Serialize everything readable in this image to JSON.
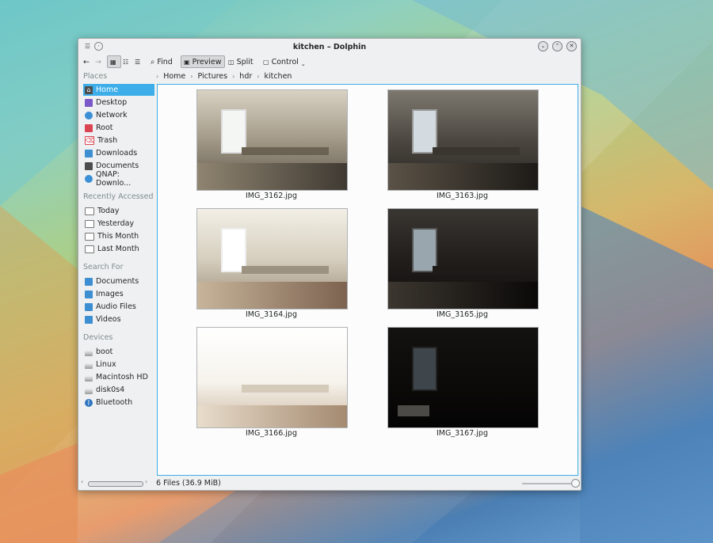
{
  "window": {
    "title": "kitchen – Dolphin"
  },
  "toolbar": {
    "find_label": "Find",
    "preview_label": "Preview",
    "split_label": "Split",
    "control_label": "Control"
  },
  "breadcrumb": [
    "Home",
    "Pictures",
    "hdr",
    "kitchen"
  ],
  "sidebar": {
    "places_title": "Places",
    "places": [
      {
        "label": "Home",
        "icon": "home-icon"
      },
      {
        "label": "Desktop",
        "icon": "desktop-icon"
      },
      {
        "label": "Network",
        "icon": "network-icon"
      },
      {
        "label": "Root",
        "icon": "root-folder-icon"
      },
      {
        "label": "Trash",
        "icon": "trash-icon"
      },
      {
        "label": "Downloads",
        "icon": "downloads-folder-icon"
      },
      {
        "label": "Documents",
        "icon": "documents-folder-icon"
      },
      {
        "label": "QNAP: Downlo...",
        "icon": "network-folder-icon"
      }
    ],
    "recent_title": "Recently Accessed",
    "recent": [
      {
        "label": "Today",
        "icon": "calendar-icon"
      },
      {
        "label": "Yesterday",
        "icon": "calendar-icon"
      },
      {
        "label": "This Month",
        "icon": "calendar-icon"
      },
      {
        "label": "Last Month",
        "icon": "calendar-icon"
      }
    ],
    "search_title": "Search For",
    "search": [
      {
        "label": "Documents",
        "icon": "folder-icon"
      },
      {
        "label": "Images",
        "icon": "folder-icon"
      },
      {
        "label": "Audio Files",
        "icon": "folder-icon"
      },
      {
        "label": "Videos",
        "icon": "folder-icon"
      }
    ],
    "devices_title": "Devices",
    "devices": [
      {
        "label": "boot",
        "icon": "drive-icon"
      },
      {
        "label": "Linux",
        "icon": "drive-icon"
      },
      {
        "label": "Macintosh HD",
        "icon": "drive-icon"
      },
      {
        "label": "disk0s4",
        "icon": "drive-icon"
      },
      {
        "label": "Bluetooth",
        "icon": "bluetooth-icon"
      }
    ]
  },
  "files": [
    {
      "name": "IMG_3162.jpg"
    },
    {
      "name": "IMG_3163.jpg"
    },
    {
      "name": "IMG_3164.jpg"
    },
    {
      "name": "IMG_3165.jpg"
    },
    {
      "name": "IMG_3166.jpg"
    },
    {
      "name": "IMG_3167.jpg"
    }
  ],
  "status": {
    "text": "6 Files (36.9 MiB)"
  },
  "colors": {
    "accent": "#3daee9",
    "window_bg": "#eff0f1"
  }
}
